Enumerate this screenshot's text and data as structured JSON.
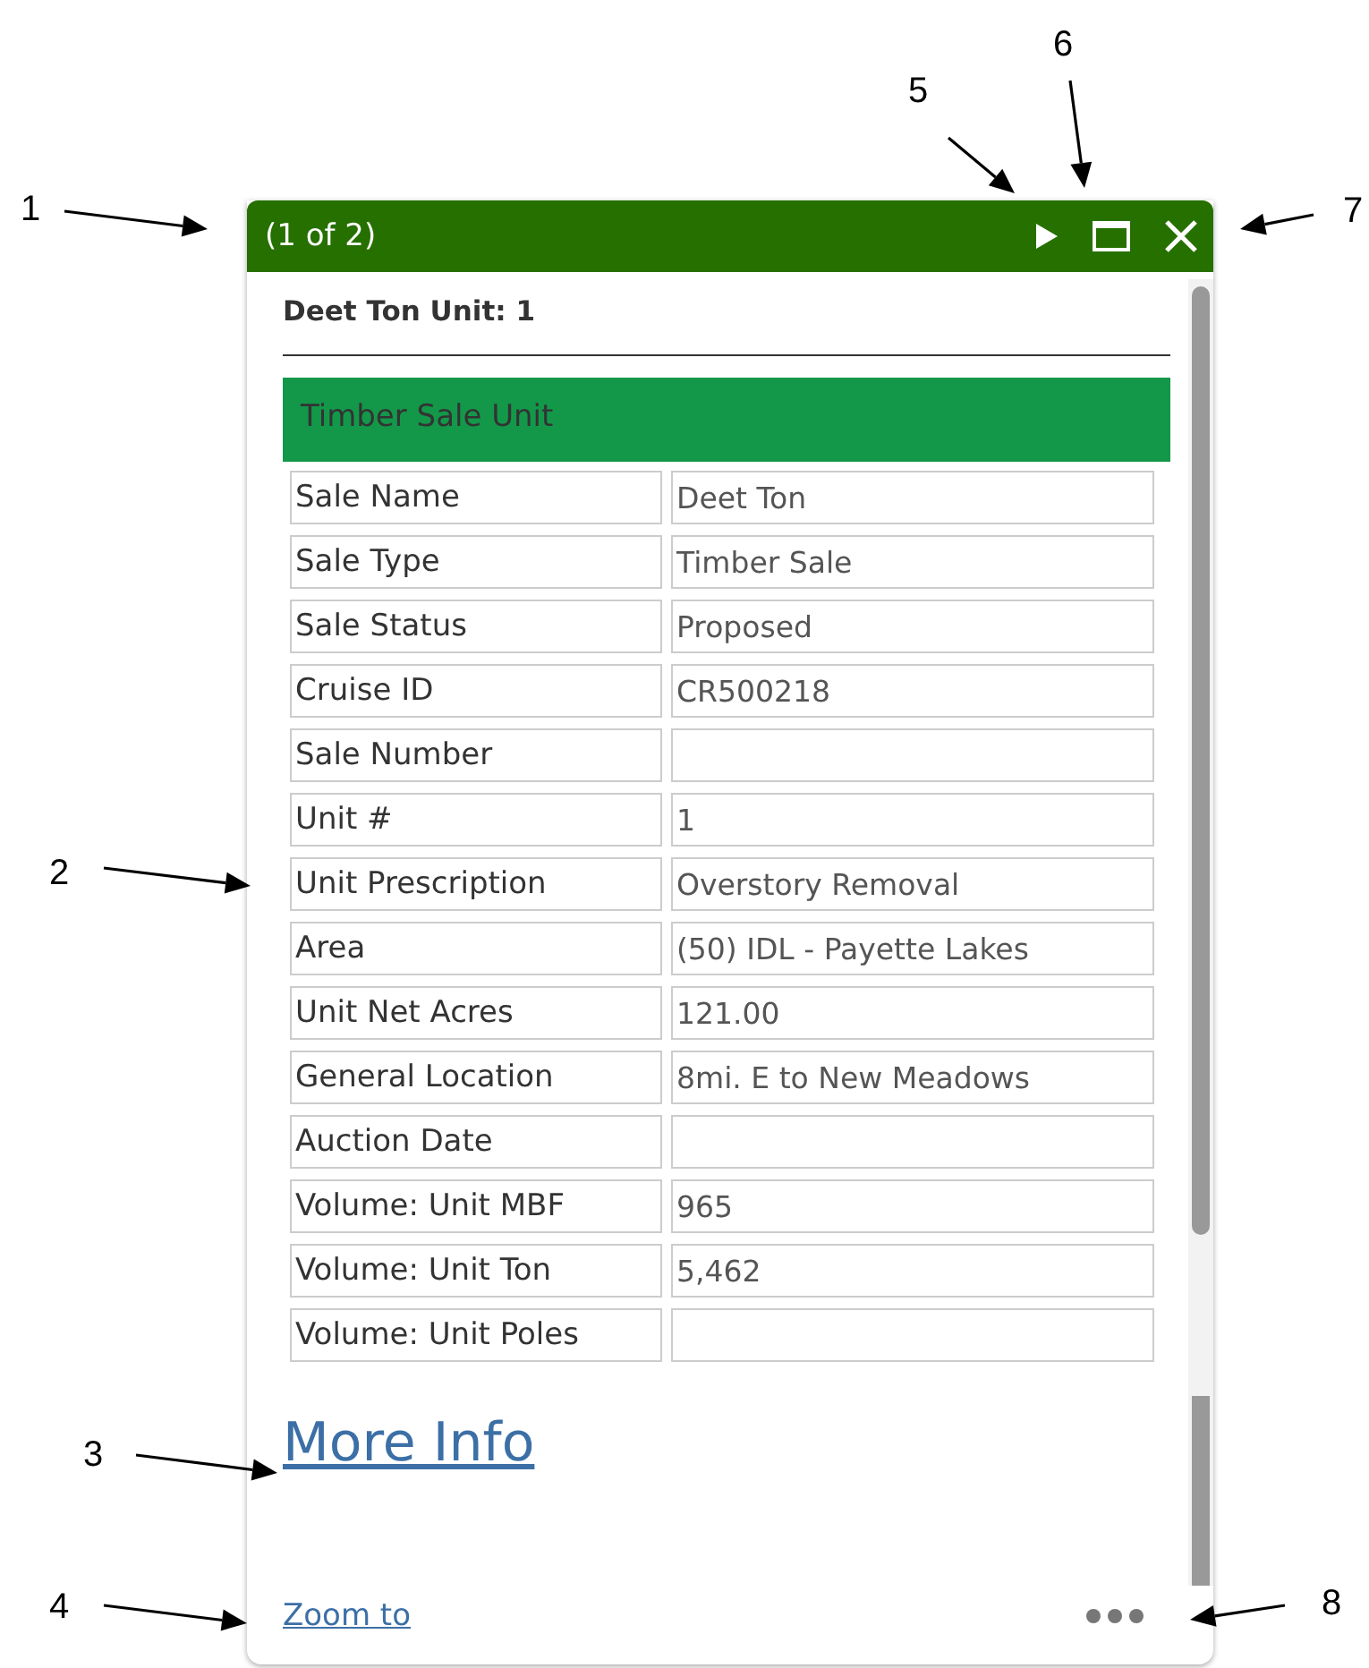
{
  "popup": {
    "header": {
      "title": "(1 of 2)",
      "buttons": [
        {
          "kind": "next"
        },
        {
          "kind": "maximize"
        },
        {
          "kind": "close"
        }
      ]
    },
    "title": "Deet Ton Unit: 1",
    "section_title": "Timber Sale Unit",
    "fields": [
      {
        "label": "Sale Name",
        "value": "Deet Ton"
      },
      {
        "label": "Sale Type",
        "value": "Timber Sale"
      },
      {
        "label": "Sale Status",
        "value": "Proposed"
      },
      {
        "label": "Cruise ID",
        "value": "CR500218"
      },
      {
        "label": "Sale Number"
      },
      {
        "label": "Unit #",
        "value": "1"
      },
      {
        "label": "Unit Prescription",
        "value": "Overstory Removal"
      },
      {
        "label": "Area",
        "value": "(50) IDL - Payette Lakes"
      },
      {
        "label": "Unit Net Acres",
        "value": "121.00"
      },
      {
        "label": "General Location",
        "value": "8mi. E to New Meadows"
      },
      {
        "label": "Auction Date"
      },
      {
        "label": "Volume: Unit MBF",
        "value": "965"
      },
      {
        "label": "Volume: Unit Ton",
        "value": "5,462"
      },
      {
        "label": "Volume: Unit Poles"
      }
    ],
    "link": "More Info",
    "footer": {
      "action": "Zoom to"
    }
  },
  "callouts": [
    {
      "number": "1"
    },
    {
      "number": "2"
    },
    {
      "number": "3"
    },
    {
      "number": "4"
    },
    {
      "number": "5"
    },
    {
      "number": "6"
    },
    {
      "number": "7"
    },
    {
      "number": "8"
    }
  ]
}
